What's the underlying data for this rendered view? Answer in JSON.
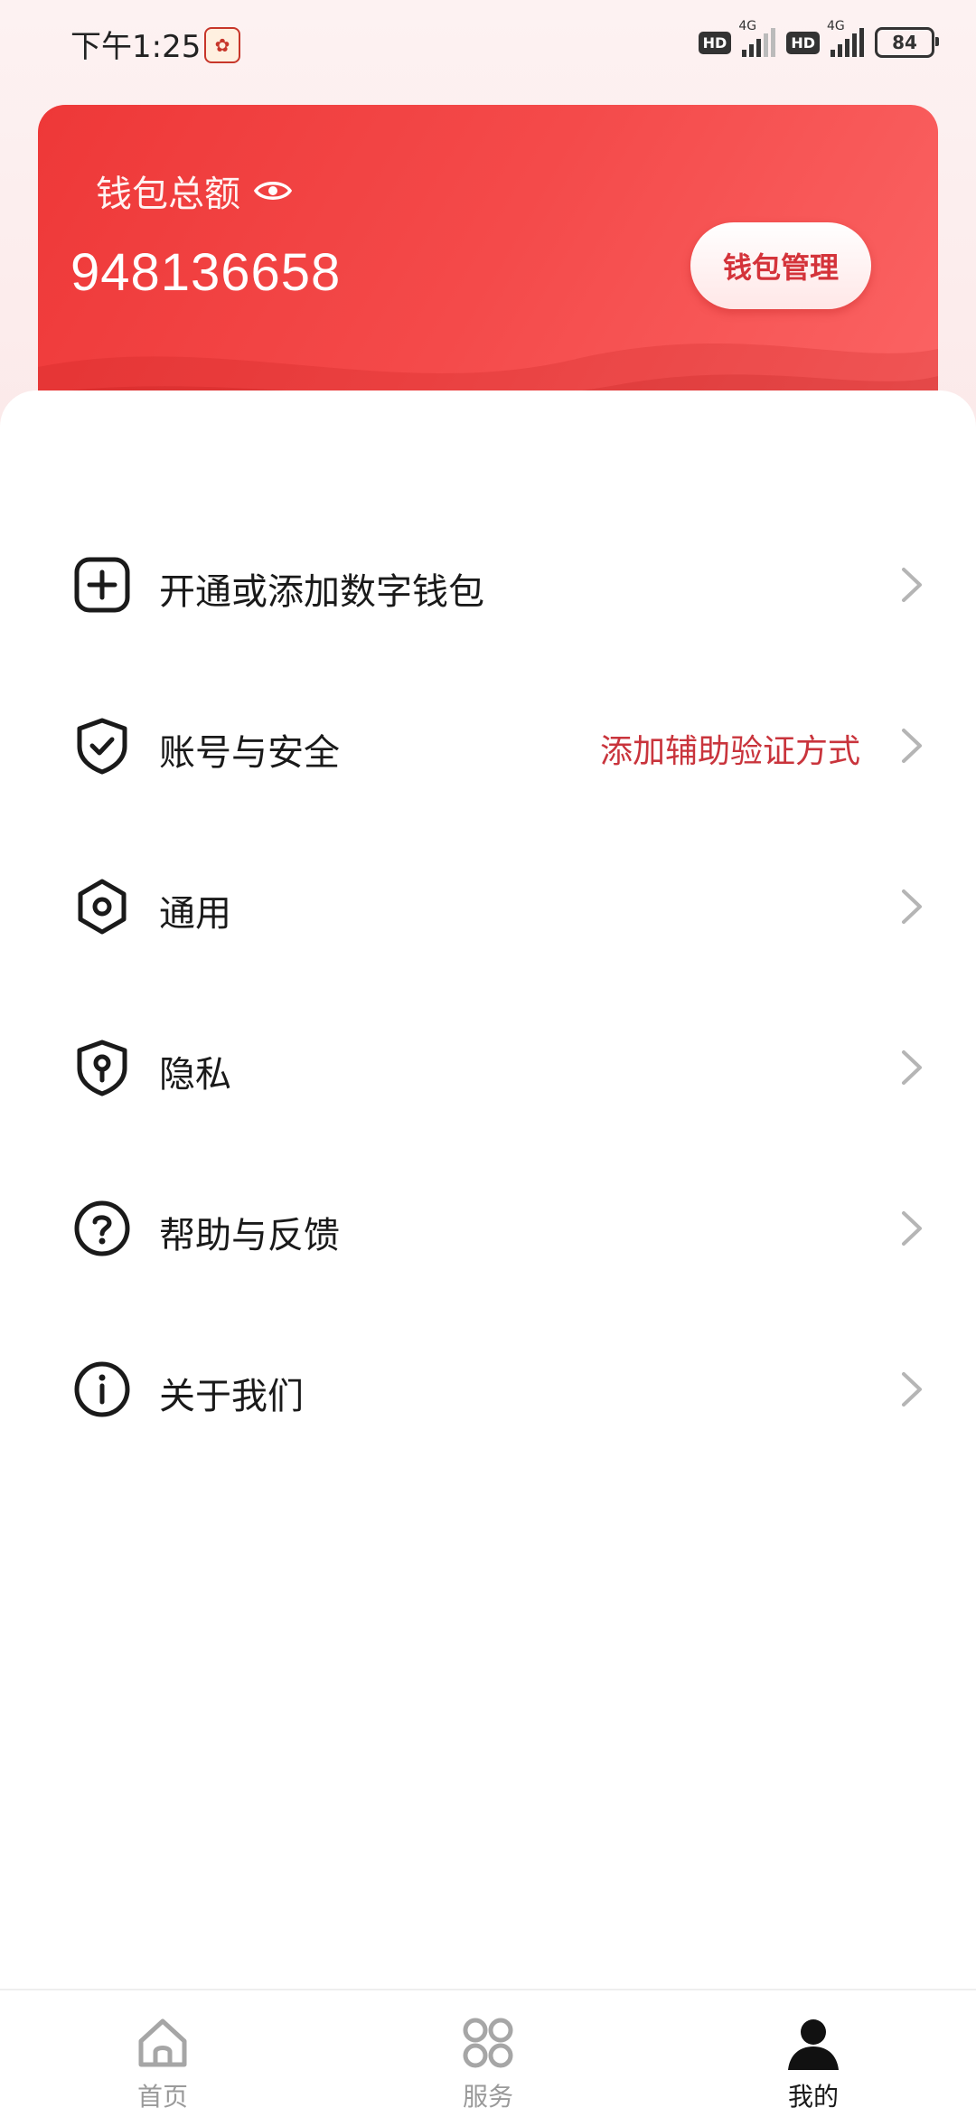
{
  "status_bar": {
    "time": "下午1:25",
    "hd1": "HD",
    "net1": "4G",
    "hd2": "HD",
    "net2": "4G",
    "battery": "84"
  },
  "wallet": {
    "title": "钱包总额",
    "amount": "948136658",
    "manage_label": "钱包管理"
  },
  "menu": [
    {
      "label": "开通或添加数字钱包",
      "icon": "plus-square-icon",
      "hint": ""
    },
    {
      "label": "账号与安全",
      "icon": "shield-check-icon",
      "hint": "添加辅助验证方式"
    },
    {
      "label": "通用",
      "icon": "hexagon-settings-icon",
      "hint": ""
    },
    {
      "label": "隐私",
      "icon": "shield-keyhole-icon",
      "hint": ""
    },
    {
      "label": "帮助与反馈",
      "icon": "question-circle-icon",
      "hint": ""
    },
    {
      "label": "关于我们",
      "icon": "info-circle-icon",
      "hint": ""
    }
  ],
  "tabs": [
    {
      "label": "首页",
      "icon": "home-icon",
      "active": false
    },
    {
      "label": "服务",
      "icon": "grid-services-icon",
      "active": false
    },
    {
      "label": "我的",
      "icon": "person-icon",
      "active": true
    }
  ],
  "colors": {
    "accent_red": "#ee3838",
    "hint_red": "#c9343c"
  }
}
